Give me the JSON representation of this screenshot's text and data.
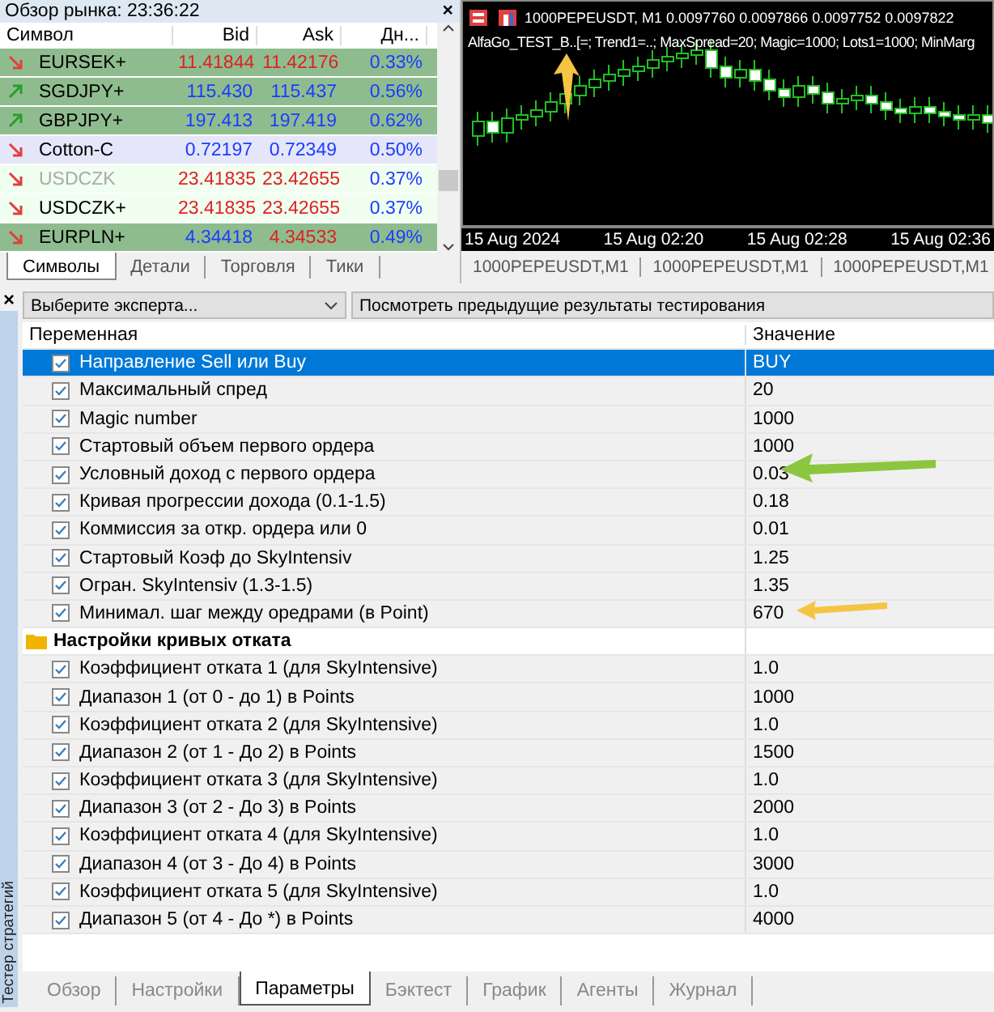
{
  "market_watch": {
    "title": "Обзор рынка: 23:36:22",
    "close": "×",
    "columns": [
      "Символ",
      "Bid",
      "Ask",
      "Дн..."
    ],
    "rows": [
      {
        "symbol": "EURSEK+",
        "bid": "11.41844",
        "ask": "11.42176",
        "change": "0.33%",
        "rising": false,
        "bid_up": false,
        "ask_up": false,
        "color": "#8fbc8f",
        "disabled": false
      },
      {
        "symbol": "SGDJPY+",
        "bid": "115.430",
        "ask": "115.437",
        "change": "0.56%",
        "rising": true,
        "bid_up": true,
        "ask_up": true,
        "color": "#8fbc8f",
        "disabled": false
      },
      {
        "symbol": "GBPJPY+",
        "bid": "197.413",
        "ask": "197.419",
        "change": "0.62%",
        "rising": true,
        "bid_up": true,
        "ask_up": true,
        "color": "#8fbc8f",
        "disabled": false
      },
      {
        "symbol": "Cotton-C",
        "bid": "0.72197",
        "ask": "0.72349",
        "change": "0.50%",
        "rising": false,
        "bid_up": true,
        "ask_up": true,
        "color": "#e6e6fa",
        "disabled": false
      },
      {
        "symbol": "USDCZK",
        "bid": "23.41835",
        "ask": "23.42655",
        "change": "0.37%",
        "rising": false,
        "bid_up": false,
        "ask_up": false,
        "color": "#f0fff0",
        "disabled": true
      },
      {
        "symbol": "USDCZK+",
        "bid": "23.41835",
        "ask": "23.42655",
        "change": "0.37%",
        "rising": false,
        "bid_up": false,
        "ask_up": false,
        "color": "#f0fff0",
        "disabled": false
      },
      {
        "symbol": "EURPLN+",
        "bid": "4.34418",
        "ask": "4.34533",
        "change": "0.49%",
        "rising": false,
        "bid_up": true,
        "ask_up": false,
        "color": "#8fbc8f",
        "disabled": false
      }
    ],
    "tabs": [
      {
        "label": "Символы",
        "selected": true
      },
      {
        "label": "Детали",
        "selected": false
      },
      {
        "label": "Торговля",
        "selected": false
      },
      {
        "label": "Тики",
        "selected": false
      }
    ]
  },
  "chart": {
    "title": "1000PEPEUSDT, M1  0.0097760 0.0097866 0.0097752 0.0097822",
    "expert_line": "AlfaGo_TEST_B..[=; Trend1=..; MaxSpread=20; Magic=1000; Lots1=1000; MinMarg",
    "time_labels": [
      "15 Aug 2024",
      "15 Aug 02:20",
      "15 Aug 02:28",
      "15 Aug 02:36"
    ],
    "tabs": [
      {
        "label": "1000PEPEUSDT,M1",
        "selected": false
      },
      {
        "label": "1000PEPEUSDT,M1",
        "selected": false
      },
      {
        "label": "1000PEPEUSDT,M1",
        "selected": false
      }
    ]
  },
  "tester": {
    "side_label": "Тестер стратегий",
    "close": "×",
    "expert_select": "Выберите эксперта...",
    "history_button": "Посмотреть предыдущие результаты тестирования",
    "columns": [
      "Переменная",
      "Значение"
    ],
    "rows": [
      {
        "kind": "param",
        "name": "Направление Sell или Buy",
        "value": "BUY",
        "checked": true,
        "selected": true
      },
      {
        "kind": "param",
        "name": "Максимальный спред",
        "value": "20",
        "checked": true,
        "selected": false
      },
      {
        "kind": "param",
        "name": "Magic number",
        "value": "1000",
        "checked": true,
        "selected": false
      },
      {
        "kind": "param",
        "name": "Стартовый объем первого ордера",
        "value": "1000",
        "checked": true,
        "selected": false
      },
      {
        "kind": "param",
        "name": "Условный доход с первого ордера",
        "value": "0.03",
        "checked": true,
        "selected": false
      },
      {
        "kind": "param",
        "name": "Кривая прогрессии дохода (0.1-1.5)",
        "value": "0.18",
        "checked": true,
        "selected": false
      },
      {
        "kind": "param",
        "name": "Коммиссия за откр. ордера или 0",
        "value": "0.01",
        "checked": true,
        "selected": false
      },
      {
        "kind": "param",
        "name": "Стартовый Коэф до SkyIntensiv",
        "value": "1.25",
        "checked": true,
        "selected": false
      },
      {
        "kind": "param",
        "name": "Огран. SkyIntensiv (1.3-1.5)",
        "value": "1.35",
        "checked": true,
        "selected": false
      },
      {
        "kind": "param",
        "name": "Минимал. шаг между оредрами (в Point)",
        "value": "670",
        "checked": true,
        "selected": false
      },
      {
        "kind": "group",
        "name": "Настройки кривых отката"
      },
      {
        "kind": "param",
        "name": "Коэффициент отката 1 (для  SkyIntensive)",
        "value": "1.0",
        "checked": true,
        "selected": false
      },
      {
        "kind": "param",
        "name": "Диапазон  1 (от 0 - до 1) в Points",
        "value": "1000",
        "checked": true,
        "selected": false
      },
      {
        "kind": "param",
        "name": "Коэффициент отката 2 (для  SkyIntensive)",
        "value": "1.0",
        "checked": true,
        "selected": false
      },
      {
        "kind": "param",
        "name": "Диапазон  2 (от 1 - До 2) в Points",
        "value": "1500",
        "checked": true,
        "selected": false
      },
      {
        "kind": "param",
        "name": "Коэффициент отката 3 (для  SkyIntensive)",
        "value": "1.0",
        "checked": true,
        "selected": false
      },
      {
        "kind": "param",
        "name": "Диапазон  3 (от 2 - До 3) в Points",
        "value": "2000",
        "checked": true,
        "selected": false
      },
      {
        "kind": "param",
        "name": "Коэффициент отката 4 (для  SkyIntensive)",
        "value": "1.0",
        "checked": true,
        "selected": false
      },
      {
        "kind": "param",
        "name": "Диапазон  4 (от 3 - До 4) в Points",
        "value": "3000",
        "checked": true,
        "selected": false
      },
      {
        "kind": "param",
        "name": "Коэффициент отката 5 (для  SkyIntensive)",
        "value": "1.0",
        "checked": true,
        "selected": false
      },
      {
        "kind": "param",
        "name": "Диапазон  5 (от 4 - До *) в Points",
        "value": "4000",
        "checked": true,
        "selected": false
      }
    ],
    "tabs": [
      {
        "label": "Обзор",
        "selected": false
      },
      {
        "label": "Настройки",
        "selected": false
      },
      {
        "label": "Параметры",
        "selected": true
      },
      {
        "label": "Бэктест",
        "selected": false
      },
      {
        "label": "График",
        "selected": false
      },
      {
        "label": "Агенты",
        "selected": false
      },
      {
        "label": "Журнал",
        "selected": false
      }
    ]
  }
}
